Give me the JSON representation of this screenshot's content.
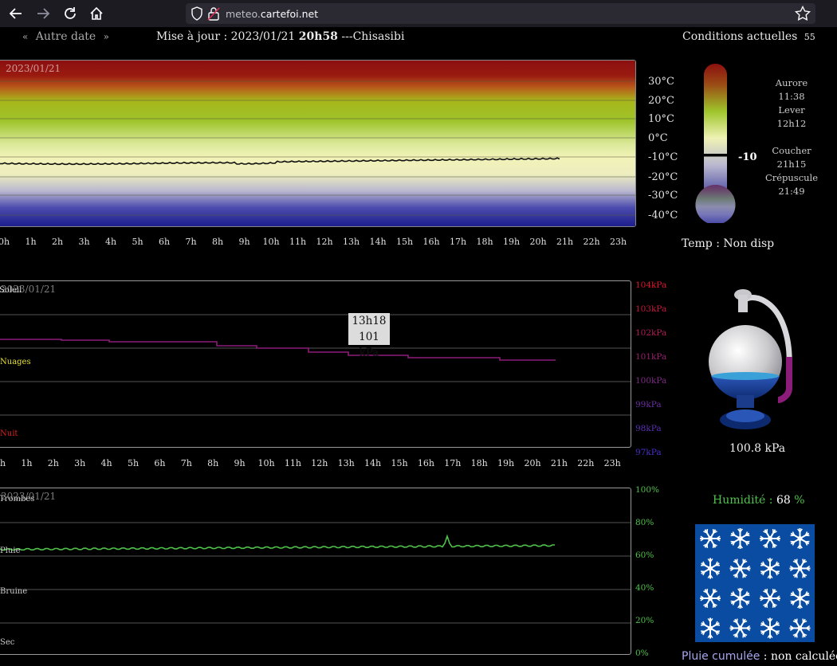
{
  "browser": {
    "url_prefix": "meteo.",
    "url_domain": "cartefoi.net"
  },
  "header": {
    "prev_symbol": "«",
    "date_label": "Autre date",
    "next_symbol": "»",
    "update_prefix": "Mise à jour : 2023/01/21 ",
    "update_time": "20h58",
    "update_suffix": " ---Chisasibi",
    "conditions_title": "Conditions actuelles",
    "conditions_count": "55"
  },
  "temp_chart": {
    "date": "2023/01/21",
    "y_ticks": [
      "30°C",
      "20°C",
      "10°C",
      "0°C",
      "-10°C",
      "-20°C",
      "-30°C",
      "-40°C"
    ],
    "x_ticks": [
      "0h",
      "1h",
      "2h",
      "3h",
      "4h",
      "5h",
      "6h",
      "7h",
      "8h",
      "9h",
      "10h",
      "11h",
      "12h",
      "13h",
      "14h",
      "15h",
      "16h",
      "17h",
      "18h",
      "19h",
      "20h",
      "21h",
      "22h",
      "23h"
    ]
  },
  "thermometer": {
    "value": "-10",
    "status": "Temp : Non disp"
  },
  "sun": {
    "aurore_label": "Aurore",
    "aurore_time": "11:38",
    "lever_label": "Lever",
    "lever_time": "12h12",
    "coucher_label": "Coucher",
    "coucher_time": "21h15",
    "crepuscule_label": "Crépuscule",
    "crepuscule_time": "21:49"
  },
  "pressure_chart": {
    "date": "2023/01/21",
    "lbl_soleil": "Soleil",
    "lbl_nuages": "Nuages",
    "lbl_nuit": "Nuit",
    "y_ticks": [
      "104kPa",
      "103kPa",
      "102kPa",
      "101kPa",
      "100kPa",
      "99kPa",
      "98kPa",
      "97kPa"
    ],
    "tooltip_time": "13h18",
    "tooltip_value": "101 kPa"
  },
  "barometer": {
    "value": "100.8 kPa"
  },
  "humidity_chart": {
    "date": "2023/01/21",
    "lbl_trombes": "Trombes",
    "lbl_pluie": "Pluie",
    "lbl_bruine": "Bruine",
    "lbl_sec": "Sec",
    "y_ticks": [
      "100%",
      "80%",
      "60%",
      "40%",
      "20%",
      "0%"
    ]
  },
  "humidity": {
    "label": "Humidité : ",
    "value": "68",
    "unit": " %"
  },
  "rain": {
    "label": "Pluie cumulée",
    "sep": " : ",
    "value": "non calculée"
  },
  "colors": {
    "pressure_line": "#8b1c7a",
    "humidity_line": "#4fc04a",
    "temp_line": "#111111"
  }
}
